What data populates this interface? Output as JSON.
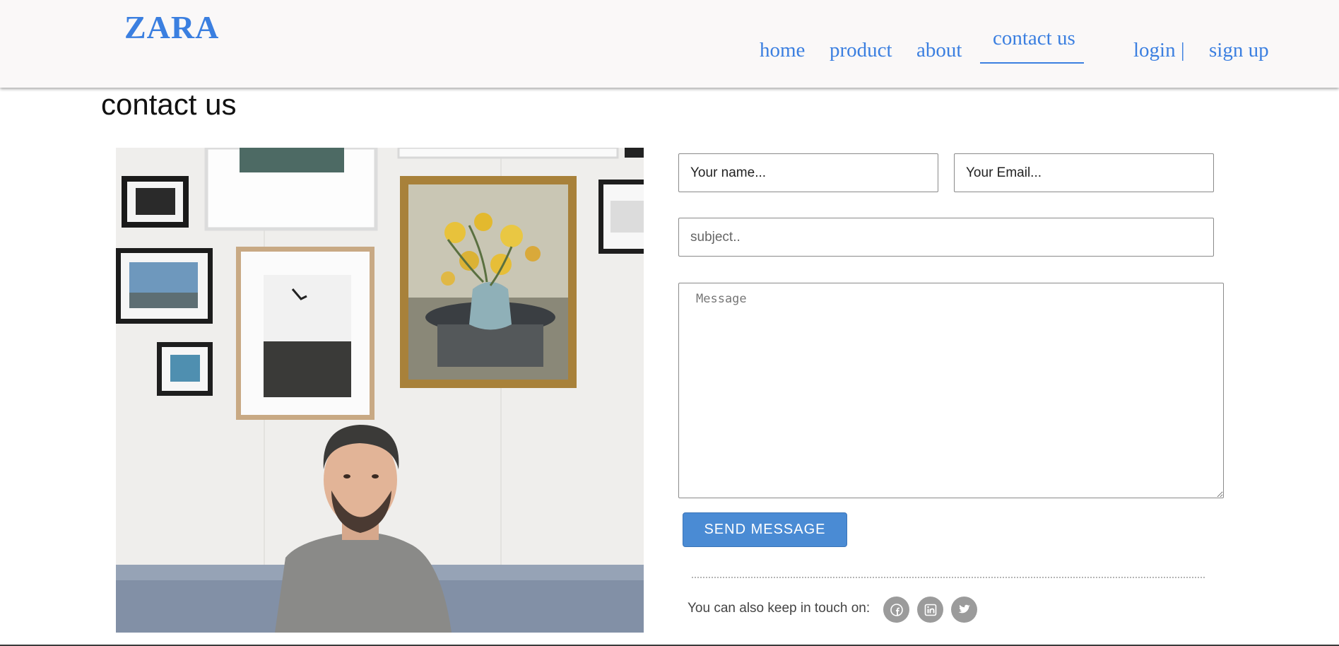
{
  "brand": {
    "logo": "ZARA",
    "accent_color": "#3b7fe0"
  },
  "nav": {
    "home": "home",
    "product": "product",
    "about": "about",
    "contact": "contact us",
    "login": "login |",
    "signup": "sign up",
    "active": "contact us"
  },
  "page": {
    "title": "contact us"
  },
  "photo": {
    "subject": "man seated on grey sofa in front of a gallery wall of framed pictures"
  },
  "form": {
    "name_placeholder": "Your name...",
    "email_placeholder": "Your Email...",
    "subject_placeholder": "subject..",
    "message_placeholder": "Message",
    "send_label": "SEND MESSAGE",
    "button_color": "#4a8bd4"
  },
  "social": {
    "text": "You can also keep in touch on:",
    "icons": [
      "facebook-icon",
      "linkedin-icon",
      "twitter-icon"
    ]
  }
}
